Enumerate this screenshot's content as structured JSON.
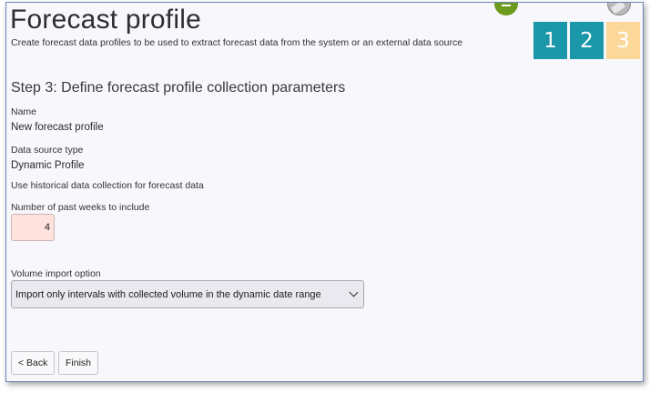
{
  "header": {
    "title": "Forecast profile",
    "subtitle": "Create forecast data profiles to be used to extract forecast data from the system or an external data source"
  },
  "steps": [
    {
      "label": "1",
      "state": "done",
      "color": "#1a97a8"
    },
    {
      "label": "2",
      "state": "done",
      "color": "#1a97a8"
    },
    {
      "label": "3",
      "state": "current",
      "color": "#fbd89a"
    }
  ],
  "section": {
    "title": "Step 3: Define forecast profile collection parameters"
  },
  "fields": {
    "name_label": "Name",
    "name_value": "New forecast profile",
    "source_label": "Data source type",
    "source_value": "Dynamic Profile",
    "note": "Use historical data collection for forecast data",
    "weeks_label": "Number of past weeks to include",
    "weeks_value": "4",
    "volume_label": "Volume import option",
    "volume_selected": "Import only intervals with collected volume in the dynamic date range"
  },
  "buttons": {
    "back": "< Back",
    "finish": "Finish"
  },
  "icons": [
    "add-icon",
    "user-avatar-icon",
    "chevron-down-icon"
  ]
}
